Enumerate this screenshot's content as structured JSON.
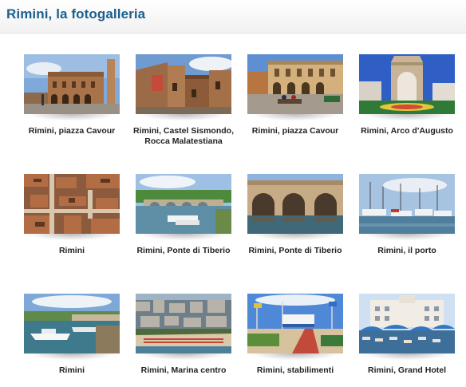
{
  "header": {
    "title": "Rimini, la fotogalleria"
  },
  "gallery": {
    "items": [
      {
        "caption": "Rimini, piazza Cavour",
        "image": "piazza-cavour-palazzo-photo"
      },
      {
        "caption": "Rimini, Castel Sismondo, Rocca Malatestiana",
        "image": "castel-sismondo-photo"
      },
      {
        "caption": "Rimini, piazza Cavour",
        "image": "piazza-cavour-square-photo"
      },
      {
        "caption": "Rimini, Arco d'Augusto",
        "image": "arco-augusto-photo"
      },
      {
        "caption": "Rimini",
        "image": "rimini-aerial-rooftops-photo"
      },
      {
        "caption": "Rimini, Ponte di Tiberio",
        "image": "ponte-tiberio-canal-photo"
      },
      {
        "caption": "Rimini, Ponte di Tiberio",
        "image": "ponte-tiberio-arches-photo"
      },
      {
        "caption": "Rimini, il porto",
        "image": "porto-boats-photo"
      },
      {
        "caption": "Rimini",
        "image": "rimini-marina-photo"
      },
      {
        "caption": "Rimini, Marina centro",
        "image": "marina-centro-aerial-photo"
      },
      {
        "caption": "Rimini, stabilimenti",
        "image": "stabilimenti-beach-photo"
      },
      {
        "caption": "Rimini, Grand Hotel",
        "image": "grand-hotel-photo"
      }
    ]
  }
}
